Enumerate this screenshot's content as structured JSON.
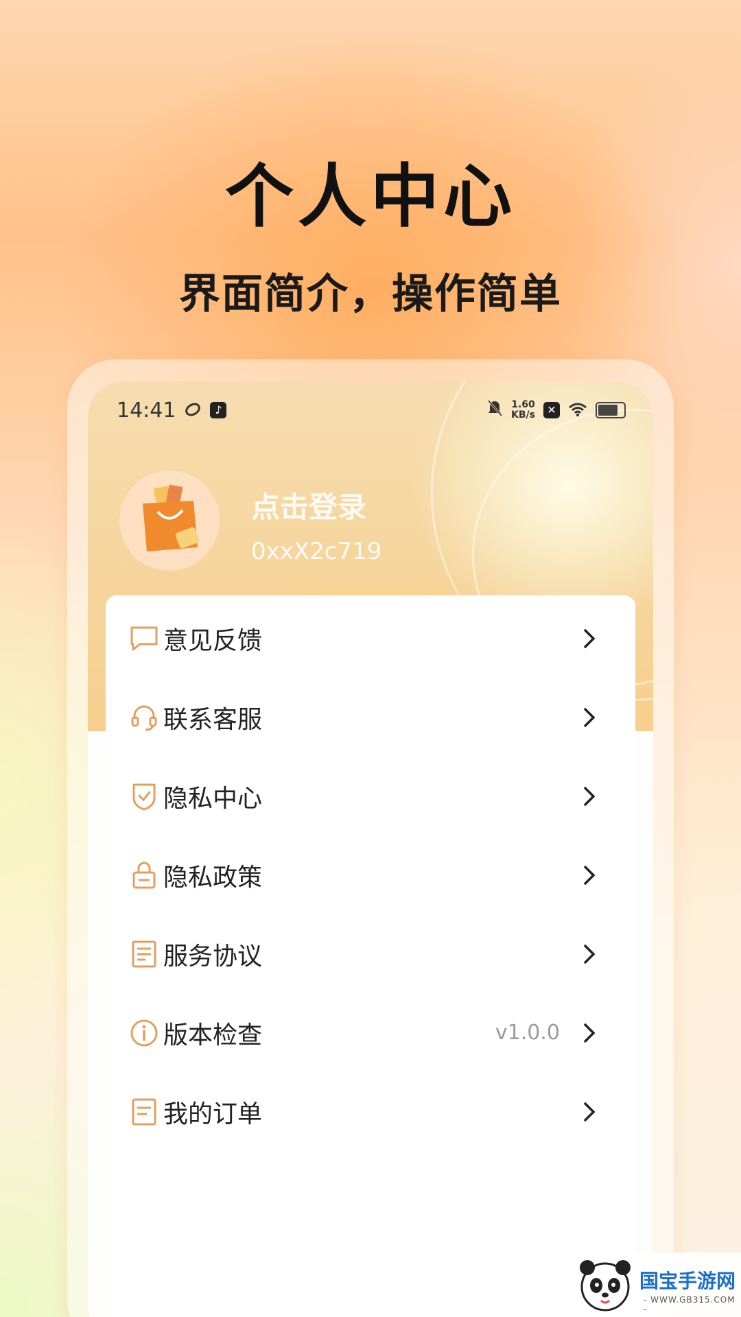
{
  "promo": {
    "headline": "个人中心",
    "subheadline": "界面简介，操作简单"
  },
  "status_bar": {
    "time": "14:41",
    "net_speed_value": "1.60",
    "net_speed_unit": "KB/s",
    "icons": [
      "loop-icon",
      "tiktok-icon",
      "bell-mute-icon",
      "close-box-icon",
      "wifi-icon",
      "battery-icon"
    ]
  },
  "profile": {
    "login_text": "点击登录",
    "user_id": "0xxX2c719",
    "avatar_icon": "shopping-bag-icon"
  },
  "menu": {
    "items": [
      {
        "label": "意见反馈",
        "icon": "chat-bubble-icon",
        "value": ""
      },
      {
        "label": "联系客服",
        "icon": "headset-icon",
        "value": ""
      },
      {
        "label": "隐私中心",
        "icon": "shield-check-icon",
        "value": ""
      },
      {
        "label": "隐私政策",
        "icon": "lock-icon",
        "value": ""
      },
      {
        "label": "服务协议",
        "icon": "document-lines-icon",
        "value": ""
      },
      {
        "label": "版本检查",
        "icon": "info-icon",
        "value": "v1.0.0"
      },
      {
        "label": "我的订单",
        "icon": "order-list-icon",
        "value": ""
      }
    ]
  },
  "colors": {
    "accent": "#e0a060",
    "text": "#222222",
    "muted": "#9a9a9a"
  },
  "watermark": {
    "brand": "国宝手游网",
    "site": "- WWW.GB315.COM -"
  }
}
